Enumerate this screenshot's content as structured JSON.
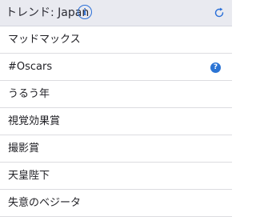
{
  "header": {
    "title": "トレンド: Japan",
    "info_icon": "info-circle-icon",
    "info_glyph": "i",
    "refresh_icon": "refresh-icon"
  },
  "trends": [
    {
      "label": "マッドマックス"
    },
    {
      "label": "#Oscars",
      "badge_icon": "help-icon",
      "badge_glyph": "?"
    },
    {
      "label": "うるう年"
    },
    {
      "label": "視覚効果賞"
    },
    {
      "label": "撮影賞"
    },
    {
      "label": "天皇陛下"
    },
    {
      "label": "失意のベジータ"
    }
  ],
  "colors": {
    "accent": "#2a6fd8",
    "header_bg": "#e9eaf0"
  }
}
